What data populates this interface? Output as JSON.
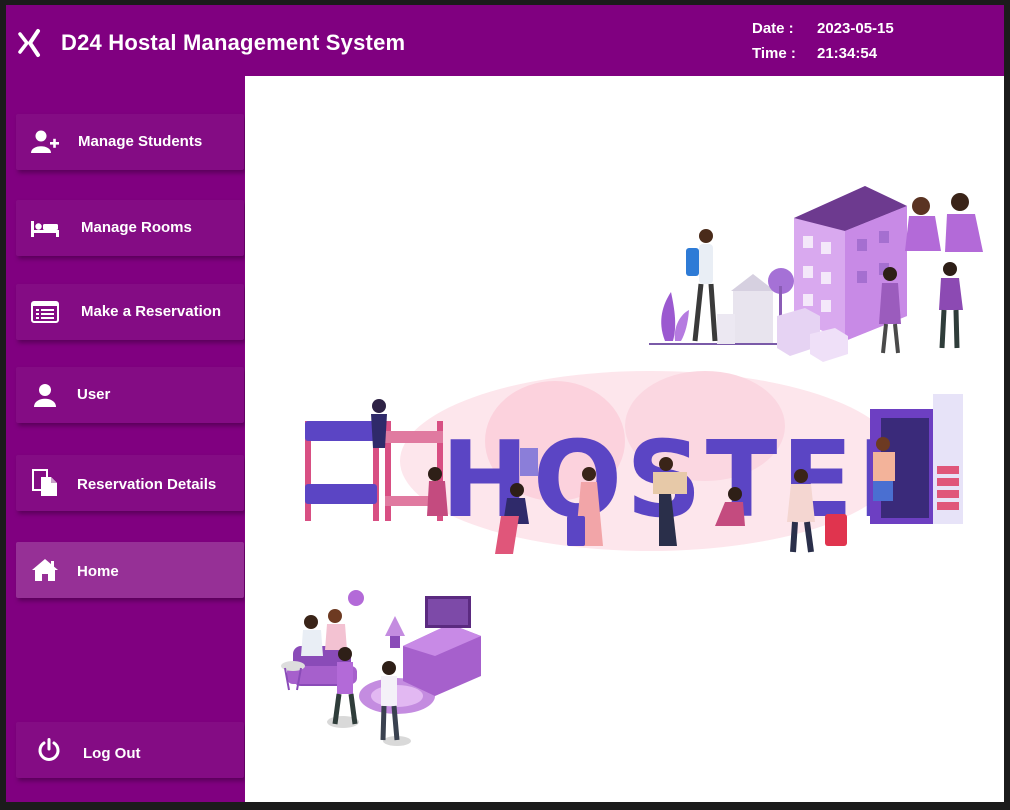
{
  "header": {
    "title": "D24 Hostal Management System",
    "date_label": "Date :",
    "date_value": "2023-05-15",
    "time_label": "Time :",
    "time_value": "21:34:54"
  },
  "sidebar": {
    "items": [
      {
        "label": "Manage Students",
        "icon": "add-user-icon"
      },
      {
        "label": "Manage Rooms",
        "icon": "bed-icon"
      },
      {
        "label": "Make a  Reservation",
        "icon": "list-window-icon"
      },
      {
        "label": "User",
        "icon": "user-icon"
      },
      {
        "label": "Reservation Details",
        "icon": "documents-icon"
      },
      {
        "label": "Home",
        "icon": "home-icon",
        "active": true
      }
    ],
    "logout": {
      "label": "Log Out",
      "icon": "power-icon"
    }
  },
  "content": {
    "banner_word": "HOSTEL"
  },
  "colors": {
    "brand": "#800080",
    "nav_button": "#840c84",
    "nav_active": "#963096",
    "content_bg": "#ffffff",
    "hostel_letters": "#5b45c4"
  }
}
